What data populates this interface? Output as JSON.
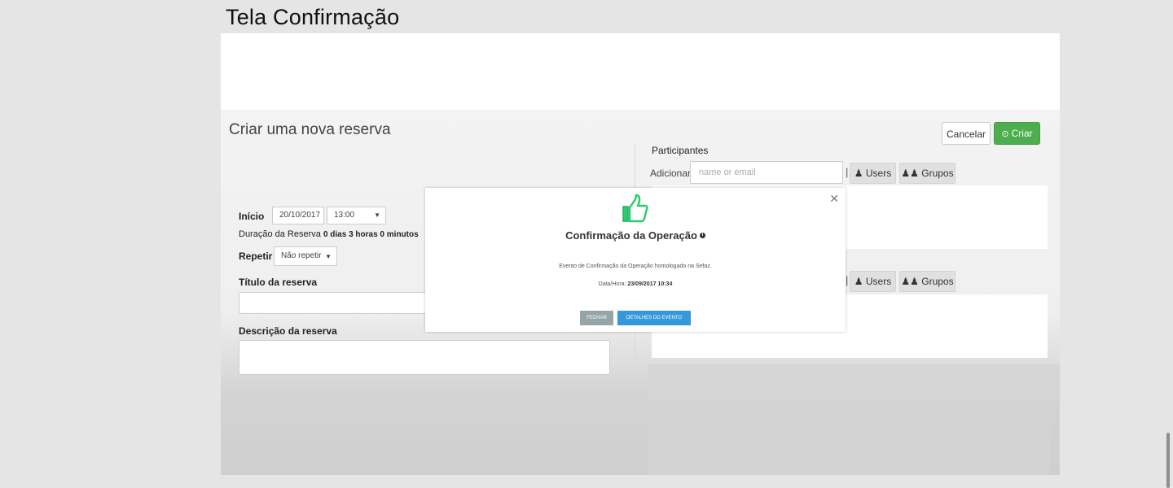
{
  "page": {
    "title": "Tela Confirmação"
  },
  "form": {
    "title": "Criar uma nova reserva",
    "cancel_label": "Cancelar",
    "create_label": "Criar",
    "inicio_label": "Início",
    "date_value": "20/10/2017",
    "time_value": "13:00",
    "duracao_label": "Duração da Reserva",
    "duracao_value": "0 dias 3 horas 0 minutos",
    "repetir_label": "Repetir",
    "repetir_value": "Não repetir",
    "titulo_label": "Título da reserva",
    "descricao_label": "Descrição da reserva"
  },
  "participants": {
    "heading": "Participantes",
    "add_label": "Adicionar",
    "input_placeholder": "name or email",
    "users_label": "Users",
    "groups_label": "Grupos"
  },
  "modal": {
    "title": "Confirmação da Operação",
    "message": "Evento de Confirmação da Operação homologado na Sefaz.",
    "date_label": "Data/Hora:",
    "date_value": "23/09/2017 10:34",
    "close_label": "FECHAR",
    "details_label": "DETALHES DO EVENTO"
  },
  "colors": {
    "success": "#4cae4c",
    "primary": "#3498db",
    "muted": "#95a5a6"
  },
  "icons": {
    "close": "close-icon",
    "thumbs_up": "thumbs-up-icon",
    "check_circle": "check-circle-icon",
    "user": "user-icon",
    "group": "group-icon",
    "info": "info-icon"
  }
}
